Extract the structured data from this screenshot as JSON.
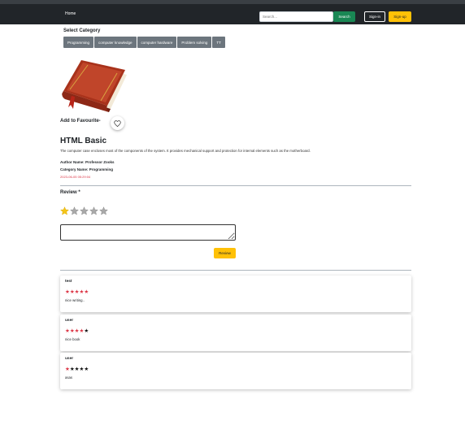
{
  "nav": {
    "home": "Home",
    "search_placeholder": "Search...",
    "search_label": "Search",
    "signin_label": "Sign-in",
    "signup_label": "Sign-up"
  },
  "categories": {
    "title": "Select Category",
    "items": [
      "Programming",
      "computer knowledge",
      "computer hardware",
      "Problem solving",
      "TT"
    ]
  },
  "book": {
    "image_icon": "book-icon",
    "favourite_label": "Add to Favourite-",
    "title": "HTML Basic",
    "description": "The computer case encloses most of the components of the system. It provides mechanical support and protection for internal elements such as the motherboard.",
    "author_label": "Author Name: ",
    "author": "Professor Zooks",
    "category_label": "Category Name: ",
    "category": "Programming",
    "date": "2023-06-05 05:29:04"
  },
  "review_form": {
    "label": "Review *",
    "selected_rating": 1,
    "max_rating": 5,
    "submit_label": "Review",
    "text_value": ""
  },
  "reviews": [
    {
      "user": "test",
      "rating": 5,
      "comment": "nice writing.."
    },
    {
      "user": "user",
      "rating": 4,
      "comment": "nice book"
    },
    {
      "user": "user",
      "rating": 1,
      "comment": "asas"
    }
  ],
  "colors": {
    "navbar": "#212529",
    "success": "#198754",
    "warning": "#ffc107",
    "secondary": "#6c757d",
    "danger": "#dc3545"
  }
}
